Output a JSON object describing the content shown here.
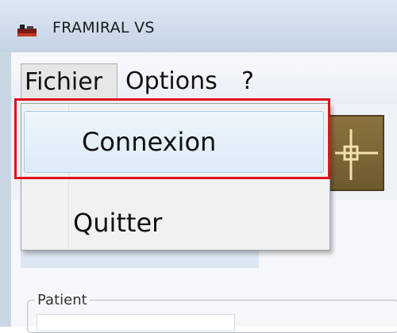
{
  "window": {
    "title": "FRAMIRAL VS"
  },
  "menubar": {
    "items": [
      {
        "label": "Fichier"
      },
      {
        "label": "Options"
      },
      {
        "label": "?"
      }
    ]
  },
  "fichier_menu": {
    "items": [
      {
        "label": "Connexion",
        "highlighted": true
      },
      {
        "label": "Quitter"
      }
    ]
  },
  "patient_group": {
    "label": "Patient"
  },
  "colors": {
    "highlight": "#e0121a",
    "hover": "#dcebf8"
  }
}
